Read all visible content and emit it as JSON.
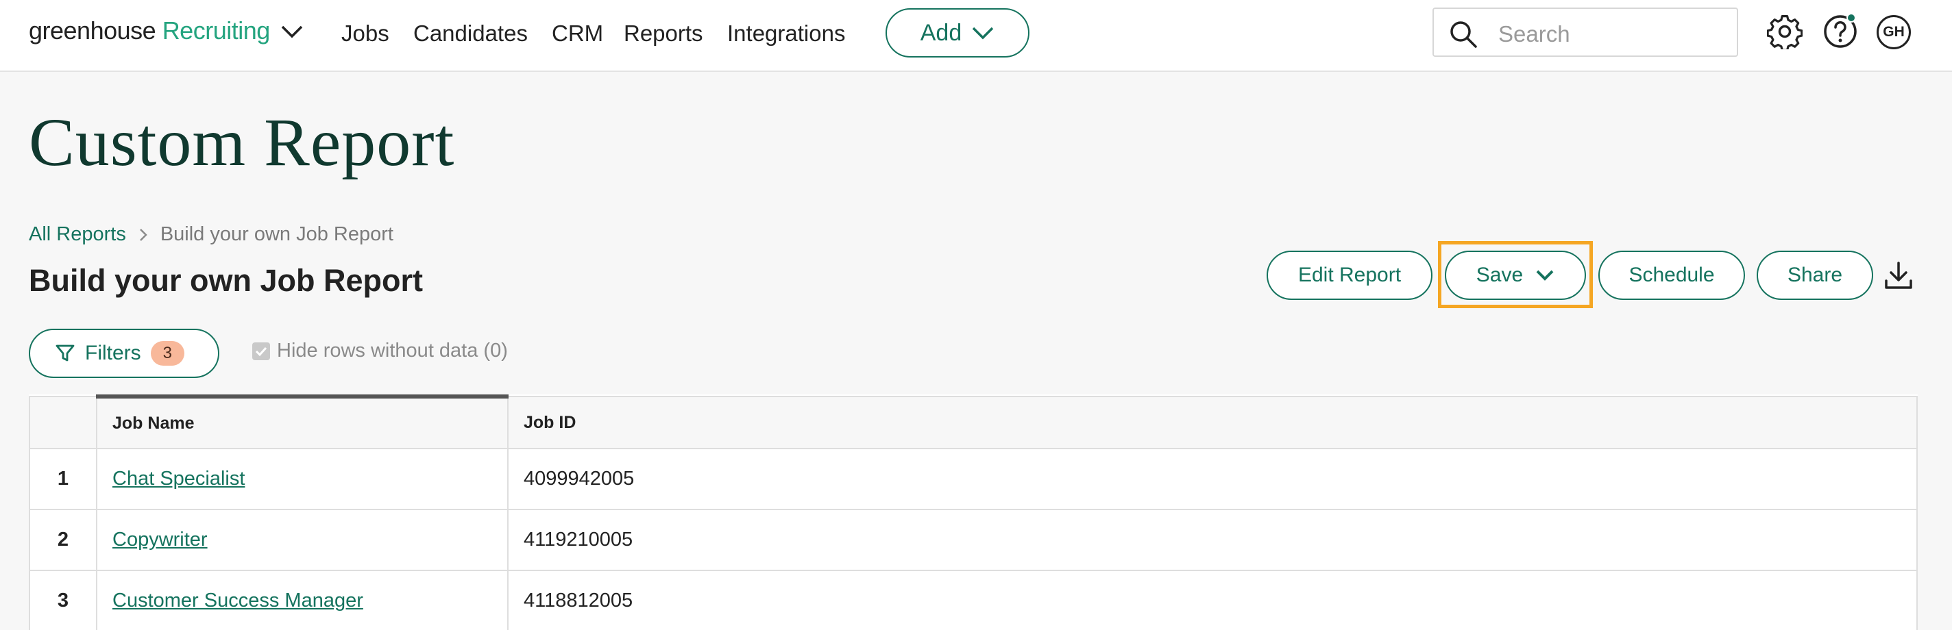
{
  "header": {
    "logo_word": "greenhouse",
    "logo_product": "Recruiting",
    "nav": [
      "Jobs",
      "Candidates",
      "CRM",
      "Reports",
      "Integrations"
    ],
    "add_label": "Add",
    "search_placeholder": "Search",
    "avatar_initials": "GH"
  },
  "page": {
    "title": "Custom Report",
    "breadcrumb": {
      "parent": "All Reports",
      "current": "Build your own Job Report"
    },
    "report_title": "Build your own Job Report"
  },
  "actions": {
    "edit": "Edit Report",
    "save": "Save",
    "schedule": "Schedule",
    "share": "Share"
  },
  "filters": {
    "label": "Filters",
    "count": "3",
    "hide_rows_label": "Hide rows without data (0)"
  },
  "table": {
    "columns": [
      "Job Name",
      "Job ID"
    ],
    "rows": [
      {
        "num": "1",
        "name": "Chat Specialist",
        "id": "4099942005"
      },
      {
        "num": "2",
        "name": "Copywriter",
        "id": "4119210005"
      },
      {
        "num": "3",
        "name": "Customer Success Manager",
        "id": "4118812005"
      }
    ]
  },
  "colors": {
    "brand": "#15735e",
    "accent": "#24a47f",
    "highlight": "#f5a623",
    "badge": "#f8b89a"
  }
}
